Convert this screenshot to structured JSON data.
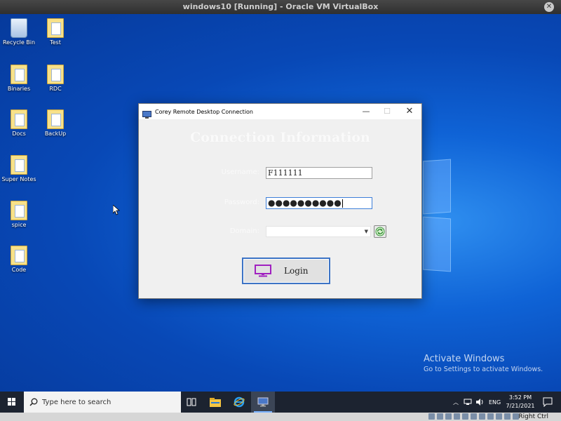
{
  "vbox": {
    "title": "windows10 [Running] - Oracle VM VirtualBox",
    "host_key": "Right Ctrl"
  },
  "desktop": {
    "icons": [
      {
        "label": "Recycle Bin"
      },
      {
        "label": "Test"
      },
      {
        "label": "Binaries"
      },
      {
        "label": "RDC"
      },
      {
        "label": "Docs"
      },
      {
        "label": "BackUp"
      },
      {
        "label": "Super Notes"
      },
      {
        "label": "spice"
      },
      {
        "label": "Code"
      }
    ],
    "activate_title": "Activate Windows",
    "activate_subtitle": "Go to Settings to activate Windows."
  },
  "dialog": {
    "title": "Corey Remote Desktop Connection",
    "heading": "Connection Information",
    "username_label": "Username:",
    "username_value": "F111111",
    "password_label": "Password:",
    "password_value": "●●●●●●●●●●",
    "domain_label": "Domain:",
    "domain_value": "",
    "login_label": "Login"
  },
  "taskbar": {
    "search_placeholder": "Type here to search",
    "language": "ENG",
    "time": "3:52 PM",
    "date": "7/21/2021"
  },
  "colors": {
    "desktop": "#0f63d6",
    "taskbar": "#1c2330",
    "accent": "#3c73c5"
  }
}
